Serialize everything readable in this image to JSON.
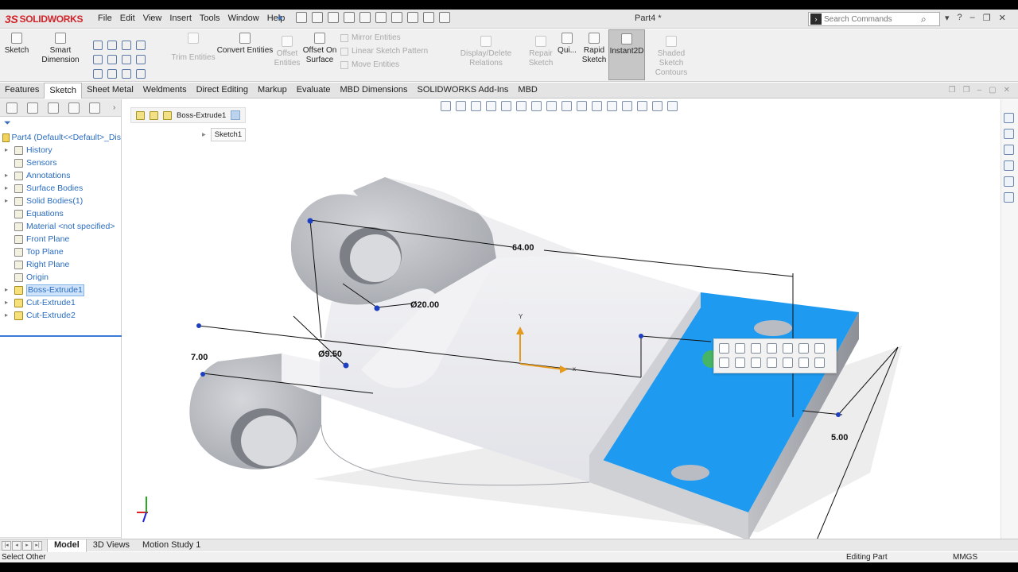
{
  "app": {
    "brand": "SOLIDWORKS",
    "brand_prefix": "3S",
    "doc_title": "Part4 *"
  },
  "menu": [
    "File",
    "Edit",
    "View",
    "Insert",
    "Tools",
    "Window",
    "Help"
  ],
  "search": {
    "placeholder": "Search Commands",
    "value": ""
  },
  "commands": {
    "sketch": "Sketch",
    "smart_dimension": "Smart Dimension",
    "trim_entities": "Trim Entities",
    "convert_entities": "Convert Entities",
    "offset_entities": "Offset Entities",
    "offset_on_surface": "Offset On Surface",
    "mirror_entities": "Mirror Entities",
    "linear_sketch_pattern": "Linear Sketch Pattern",
    "move_entities": "Move Entities",
    "display_delete_relations": "Display/Delete Relations",
    "repair_sketch": "Repair Sketch",
    "quick_snaps": "Qui...",
    "rapid_sketch": "Rapid Sketch",
    "instant2d": "Instant2D",
    "shaded_sketch_contours": "Shaded Sketch Contours"
  },
  "tabs": [
    "Features",
    "Sketch",
    "Sheet Metal",
    "Weldments",
    "Direct Editing",
    "Markup",
    "Evaluate",
    "MBD Dimensions",
    "SOLIDWORKS Add-Ins",
    "MBD"
  ],
  "active_tab": "Sketch",
  "tree": {
    "root": "Part4  (Default<<Default>_Dis",
    "items": [
      {
        "label": "History",
        "expand": true
      },
      {
        "label": "Sensors",
        "expand": false
      },
      {
        "label": "Annotations",
        "expand": true
      },
      {
        "label": "Surface Bodies",
        "expand": true
      },
      {
        "label": "Solid Bodies(1)",
        "expand": true
      },
      {
        "label": "Equations",
        "expand": false
      },
      {
        "label": "Material <not specified>",
        "expand": false
      },
      {
        "label": "Front Plane",
        "expand": false
      },
      {
        "label": "Top Plane",
        "expand": false
      },
      {
        "label": "Right Plane",
        "expand": false
      },
      {
        "label": "Origin",
        "expand": false
      },
      {
        "label": "Boss-Extrude1",
        "expand": true,
        "selected": true
      },
      {
        "label": "Cut-Extrude1",
        "expand": true
      },
      {
        "label": "Cut-Extrude2",
        "expand": true
      }
    ]
  },
  "breadcrumb": {
    "feature": "Boss-Extrude1",
    "sketch": "Sketch1"
  },
  "dimensions": {
    "d1": "64.00",
    "d2": "Ø20.00",
    "d3": "Ø9.50",
    "d4": "7.00",
    "d5": "5.00"
  },
  "axes": {
    "x": "x",
    "y": "Y"
  },
  "bottom_tabs": [
    "Model",
    "3D Views",
    "Motion Study 1"
  ],
  "active_bottom_tab": "Model",
  "status": {
    "left": "Select Other",
    "mode": "Editing Part",
    "units": "MMGS"
  },
  "colors": {
    "selected_face": "#1e9bf0",
    "brand": "#d2232a",
    "tree_text": "#2a6cbf"
  }
}
